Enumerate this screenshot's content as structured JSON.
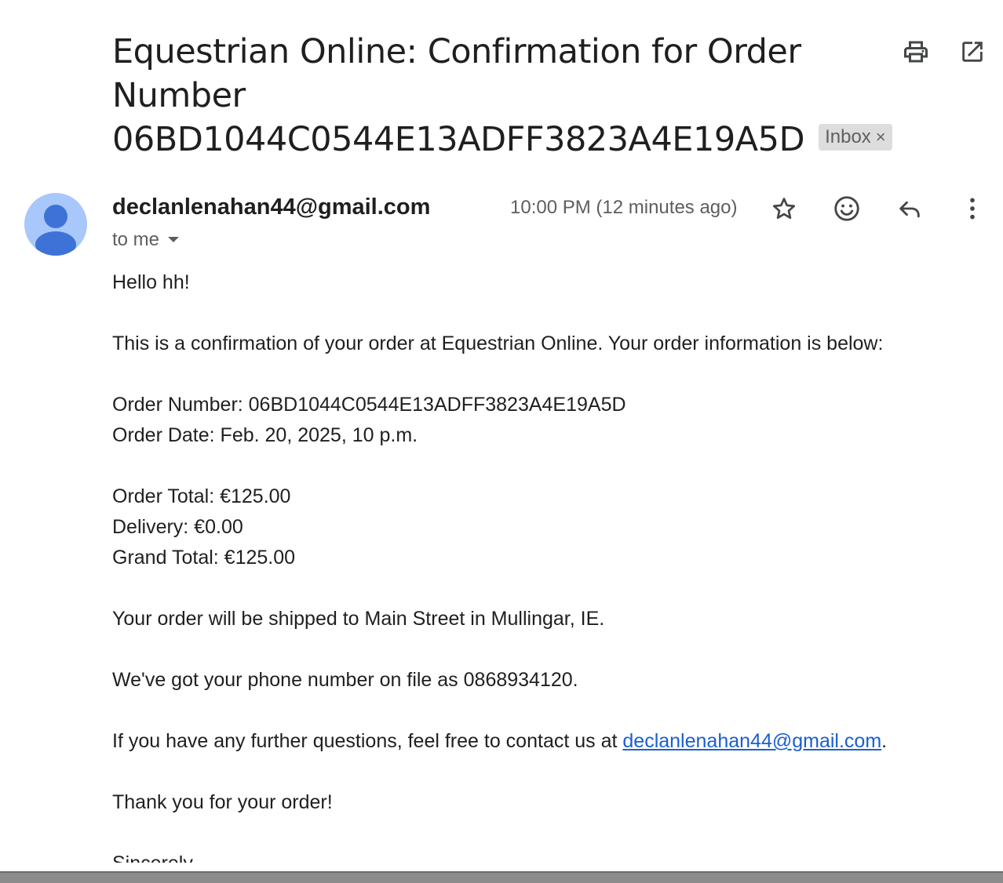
{
  "subject": {
    "line1": "Equestrian Online: Confirmation for Order",
    "line2": "Number",
    "line3": "06BD1044C0544E13ADFF3823A4E19A5D"
  },
  "label": {
    "text": "Inbox",
    "remove": "×"
  },
  "header_icons": [
    "print-icon",
    "open-in-new-window-icon"
  ],
  "sender": {
    "email": "declanlenahan44@gmail.com",
    "recipient": "to me",
    "timestamp": "10:00 PM (12 minutes ago)"
  },
  "actions": [
    "star-icon",
    "emoji-reaction-icon",
    "reply-icon",
    "more-options-icon"
  ],
  "body": {
    "greeting": "Hello hh!",
    "intro": "This is a confirmation of your order at Equestrian Online. Your order information is below:",
    "order_number": "Order Number: 06BD1044C0544E13ADFF3823A4E19A5D",
    "order_date": "Order Date: Feb. 20, 2025, 10 p.m.",
    "order_total": "Order Total: €125.00",
    "delivery": "Delivery: €0.00",
    "grand_total": "Grand Total: €125.00",
    "shipping": "Your order will be shipped to Main Street in Mullingar, IE.",
    "phone": "We've got your phone number on file as 0868934120.",
    "contact_prefix": "If you have any further questions, feel free to contact us at ",
    "contact_email": "declanlenahan44@gmail.com",
    "contact_suffix": ".",
    "thanks": "Thank you for your order!",
    "signoff": "Sincerely,"
  },
  "colors": {
    "avatar_bg": "#a8c7fa",
    "avatar_figure": "#3f72d6",
    "link": "#1a5fd0",
    "label_bg": "#dddddd"
  }
}
